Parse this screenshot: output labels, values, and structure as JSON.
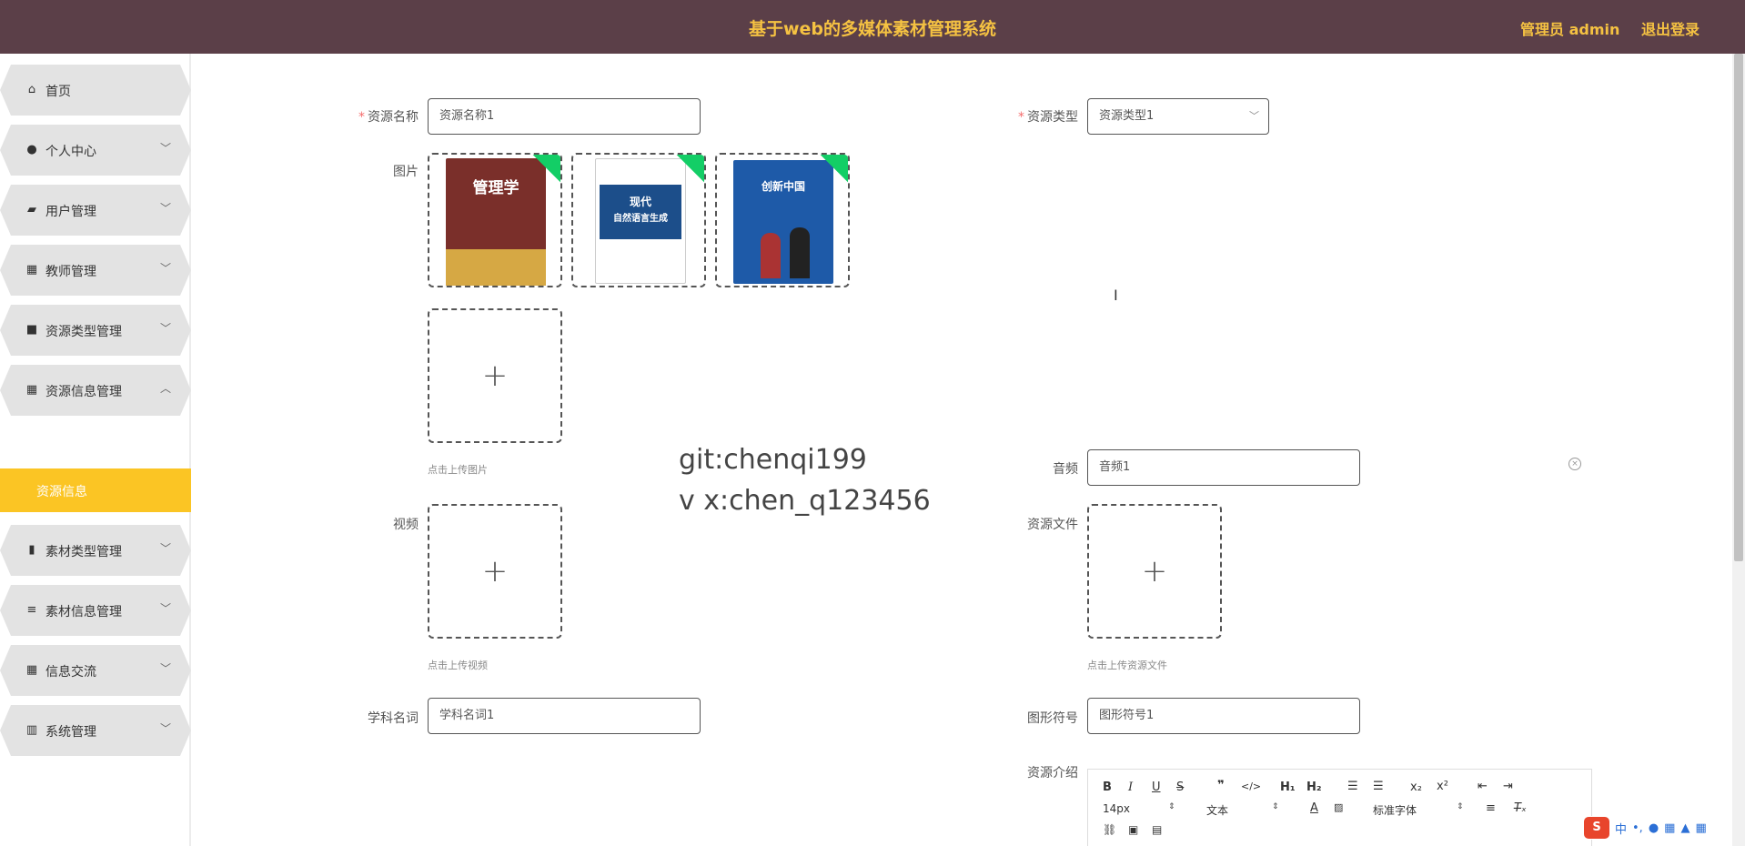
{
  "header": {
    "title": "基于web的多媒体素材管理系统",
    "admin": "管理员 admin",
    "logout": "退出登录"
  },
  "sidebar": {
    "items": [
      {
        "label": "首页",
        "icon": "home-icon",
        "chevron": ""
      },
      {
        "label": "个人中心",
        "icon": "user-icon",
        "chevron": "﹀"
      },
      {
        "label": "用户管理",
        "icon": "chat-icon",
        "chevron": "﹀"
      },
      {
        "label": "教师管理",
        "icon": "grid-icon",
        "chevron": "﹀"
      },
      {
        "label": "资源类型管理",
        "icon": "briefcase-icon",
        "chevron": "﹀"
      },
      {
        "label": "资源信息管理",
        "icon": "grid-icon",
        "chevron": "︿"
      },
      {
        "label": "素材类型管理",
        "icon": "bar-chart-icon",
        "chevron": "﹀"
      },
      {
        "label": "素材信息管理",
        "icon": "sliders-icon",
        "chevron": "﹀"
      },
      {
        "label": "信息交流",
        "icon": "grid-icon",
        "chevron": "﹀"
      },
      {
        "label": "系统管理",
        "icon": "book-icon",
        "chevron": "﹀"
      }
    ],
    "sub_item": "资源信息"
  },
  "form": {
    "name_label": "资源名称",
    "name_value": "资源名称1",
    "type_label": "资源类型",
    "type_value": "资源类型1",
    "image_label": "图片",
    "image_hint": "点击上传图片",
    "books": [
      "管理学",
      "现代",
      "自然语言生成",
      "创新中国"
    ],
    "audio_label": "音频",
    "audio_value": "音频1",
    "video_label": "视频",
    "video_hint": "点击上传视频",
    "file_label": "资源文件",
    "file_hint": "点击上传资源文件",
    "subject_label": "学科名词",
    "subject_value": "学科名词1",
    "symbol_label": "图形符号",
    "symbol_value": "图形符号1",
    "intro_label": "资源介绍",
    "plus": "+"
  },
  "watermark": {
    "line1": "git:chenqi199",
    "line2": "v x:chen_q123456"
  },
  "editor": {
    "font_size": "14px",
    "text_type": "文本",
    "font_family": "标准字体"
  },
  "ime": {
    "brand": "S",
    "lang": "中"
  },
  "colors": {
    "header_bg": "#5b3f48",
    "accent": "#f5c242",
    "active_menu": "#fbc524",
    "upload_success": "#13ce66"
  }
}
